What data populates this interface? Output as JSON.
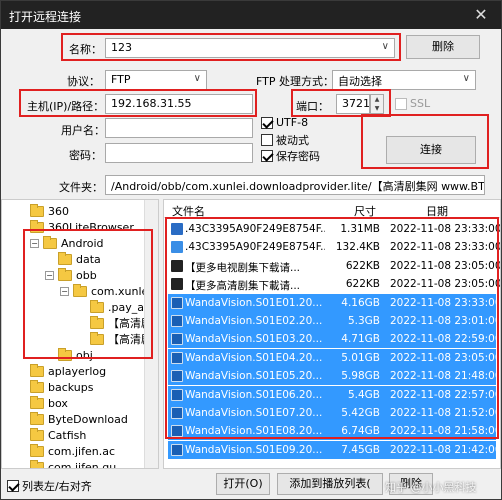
{
  "window": {
    "title": "打开远程连接",
    "close_glyph": "✕"
  },
  "form": {
    "name_label": "名称：",
    "name_value": "123",
    "delete_label": "删除",
    "protocol_label": "协议：",
    "protocol_value": "FTP",
    "ftp_mode_label": "FTP 处理方式：",
    "ftp_mode_value": "自动选择",
    "host_label": "主机(IP)/路径：",
    "host_value": "192.168.31.55",
    "port_label": "端口：",
    "port_value": "3721",
    "ssl_label": "SSL",
    "user_label": "用户名：",
    "user_value": "",
    "pass_label": "密码：",
    "pass_value": "",
    "utf8_label": "UTF-8",
    "passive_label": "被动式",
    "save_pass_label": "保存密码",
    "connect_label": "连接",
    "folder_label": "文件夹：",
    "folder_value": "/Android/obb/com.xunlei.downloadprovider.lite/【高清剧集网 www.BTHDTV.cor"
  },
  "tree": {
    "items": [
      {
        "label": "360"
      },
      {
        "label": "360LiteBrowser"
      },
      {
        "label": "Android"
      },
      {
        "label": "data"
      },
      {
        "label": "obb"
      },
      {
        "label": "com.xunlei.d"
      },
      {
        "label": ".pay_acti"
      },
      {
        "label": "【高清剧"
      },
      {
        "label": "【高清剧"
      },
      {
        "label": "obj"
      },
      {
        "label": "aplayerlog"
      },
      {
        "label": "backups"
      },
      {
        "label": "box"
      },
      {
        "label": "ByteDownload"
      },
      {
        "label": "Catfish"
      },
      {
        "label": "com.jifen.ac"
      },
      {
        "label": "com.jifen.qu"
      }
    ]
  },
  "filelist": {
    "headers": {
      "name": "文件名",
      "size": "尺寸",
      "date": "日期"
    },
    "rows": [
      {
        "icon": "mb-icon",
        "name": ".43C3395A90F249E8754F...",
        "size": "1.31MB",
        "date": "2022-11-08 23:33:00",
        "selected": false
      },
      {
        "icon": "bt-icon",
        "name": ".43C3395A90F249E8754F...",
        "size": "132.4KB",
        "date": "2022-11-08 23:33:00",
        "selected": false
      },
      {
        "icon": "nkv-icon",
        "name": "【更多电视剧集下载请...",
        "size": "622KB",
        "date": "2022-11-08 23:05:00",
        "selected": false
      },
      {
        "icon": "nkv-icon",
        "name": "【更多高清剧集下載请...",
        "size": "622KB",
        "date": "2022-11-08 23:05:00",
        "selected": false
      },
      {
        "icon": "video-icon",
        "name": "WandaVision.S01E01.20...",
        "size": "4.16GB",
        "date": "2022-11-08 23:33:00",
        "selected": true
      },
      {
        "icon": "video-icon",
        "name": "WandaVision.S01E02.20...",
        "size": "5.3GB",
        "date": "2022-11-08 23:01:00",
        "selected": true
      },
      {
        "icon": "video-icon",
        "name": "WandaVision.S01E03.20...",
        "size": "4.71GB",
        "date": "2022-11-08 22:59:00",
        "selected": true
      },
      {
        "icon": "video-icon",
        "name": "WandaVision.S01E04.20...",
        "size": "5.01GB",
        "date": "2022-11-08 23:05:00",
        "selected": true
      },
      {
        "icon": "video-icon",
        "name": "WandaVision.S01E05.20...",
        "size": "5.98GB",
        "date": "2022-11-08 21:48:00",
        "selected": true
      },
      {
        "icon": "video-icon",
        "name": "WandaVision.S01E06.20...",
        "size": "5.4GB",
        "date": "2022-11-08 22:57:00",
        "selected": true
      },
      {
        "icon": "video-icon",
        "name": "WandaVision.S01E07.20...",
        "size": "5.42GB",
        "date": "2022-11-08 21:52:00",
        "selected": true
      },
      {
        "icon": "video-icon",
        "name": "WandaVision.S01E08.20...",
        "size": "6.74GB",
        "date": "2022-11-08 21:58:00",
        "selected": true
      },
      {
        "icon": "video-icon",
        "name": "WandaVision.S01E09.20...",
        "size": "7.45GB",
        "date": "2022-11-08 21:42:00",
        "selected": true
      }
    ]
  },
  "bottom": {
    "list_align_label": "列表左/右对齐",
    "open_label": "打开(O)",
    "add_playlist_label": "添加到播放列表(",
    "delete_label": "删除",
    "watermark": "知乎 @小小黑科技"
  }
}
